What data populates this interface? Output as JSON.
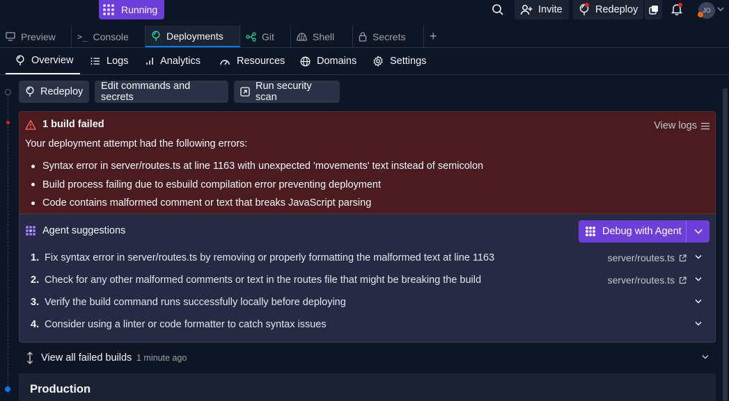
{
  "topbar": {
    "status": "Running",
    "invite_label": "Invite",
    "redeploy_label": "Redeploy",
    "avatar_initials": "JO"
  },
  "file_tabs": [
    {
      "label": "Preview",
      "icon": "monitor-icon"
    },
    {
      "label": "Console",
      "icon": "terminal-icon"
    },
    {
      "label": "Deployments",
      "icon": "deploy-icon",
      "active": true
    },
    {
      "label": "Git",
      "icon": "git-icon"
    },
    {
      "label": "Shell",
      "icon": "shell-icon"
    },
    {
      "label": "Secrets",
      "icon": "lock-icon"
    }
  ],
  "nav_tabs": [
    {
      "label": "Overview",
      "icon": "deploy-icon",
      "active": true
    },
    {
      "label": "Logs",
      "icon": "list-icon"
    },
    {
      "label": "Analytics",
      "icon": "bar-chart-icon"
    },
    {
      "label": "Resources",
      "icon": "gauge-icon"
    },
    {
      "label": "Domains",
      "icon": "globe-icon"
    },
    {
      "label": "Settings",
      "icon": "gear-icon"
    }
  ],
  "actions": {
    "redeploy": "Redeploy",
    "edit_commands": "Edit commands and secrets",
    "security_scan": "Run security scan"
  },
  "build_error": {
    "title": "1 build failed",
    "view_logs": "View logs",
    "intro": "Your deployment attempt had the following errors:",
    "errors": [
      "Syntax error in server/routes.ts at line 1163 with unexpected 'movements' text instead of semicolon",
      "Build process failing due to esbuild compilation error preventing deployment",
      "Code contains malformed comment or text that breaks JavaScript parsing"
    ]
  },
  "agent": {
    "title": "Agent suggestions",
    "debug_label": "Debug with Agent",
    "suggestions": [
      {
        "num": "1.",
        "text": "Fix syntax error in server/routes.ts by removing or properly formatting the malformed text at line 1163",
        "file": "server/routes.ts"
      },
      {
        "num": "2.",
        "text": "Check for any other malformed comments or text in the routes file that might be breaking the build",
        "file": "server/routes.ts"
      },
      {
        "num": "3.",
        "text": "Verify the build command runs successfully locally before deploying",
        "file": ""
      },
      {
        "num": "4.",
        "text": "Consider using a linter or code formatter to catch syntax issues",
        "file": ""
      }
    ]
  },
  "failed_builds": {
    "label": "View all failed builds",
    "time": "1 minute ago"
  },
  "production": {
    "title": "Production"
  },
  "colors": {
    "accent": "#6c3fd9",
    "error_bg": "#4a1c20",
    "agent_bg": "#262a45",
    "active_tab": "#0079f2"
  }
}
